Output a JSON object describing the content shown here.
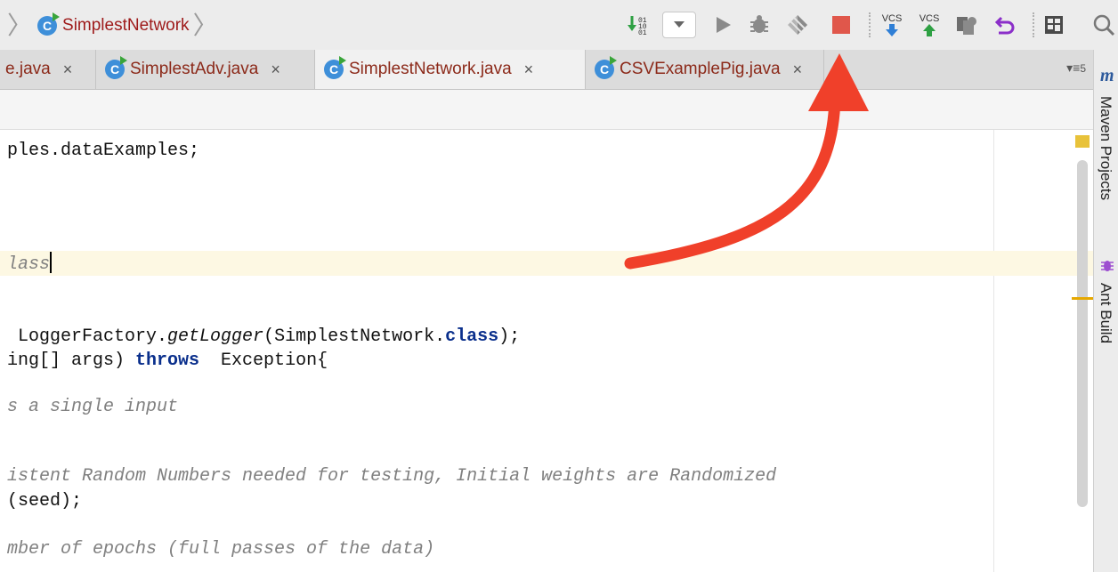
{
  "breadcrumb": {
    "icon_letter": "C",
    "label": "SimplestNetwork"
  },
  "toolbar": {
    "vcs_update_label": "VCS",
    "vcs_commit_label": "VCS",
    "colors": {
      "stop": "#e0574b",
      "run": "#3aa53a",
      "vcs_update": "#2f7fd6",
      "vcs_commit": "#2ea043"
    }
  },
  "tabs": [
    {
      "label": "e.java",
      "active": false
    },
    {
      "label": "SimplestAdv.java",
      "active": false
    },
    {
      "label": "SimplestNetwork.java",
      "active": true
    },
    {
      "label": "CSVExamplePig.java",
      "active": false
    }
  ],
  "tab_close": "×",
  "tab_more_count": "5",
  "sidebar": {
    "logo": "m",
    "maven": "Maven Projects",
    "ant": "Ant Build"
  },
  "code": {
    "l1": "ples.dataExamples;",
    "l2": "lass",
    "l3a": " LoggerFactory.",
    "l3b": "getLogger",
    "l3c": "(SimplestNetwork.",
    "l3d": "class",
    "l3e": ");",
    "l4a": "ing[] args) ",
    "l4b": "throws",
    "l4c": "  Exception{",
    "l5": "s a single input",
    "l6": "istent Random Numbers needed for testing, Initial weights are Randomized",
    "l7": "(seed);",
    "l8": "mber of epochs (full passes of the data)"
  }
}
